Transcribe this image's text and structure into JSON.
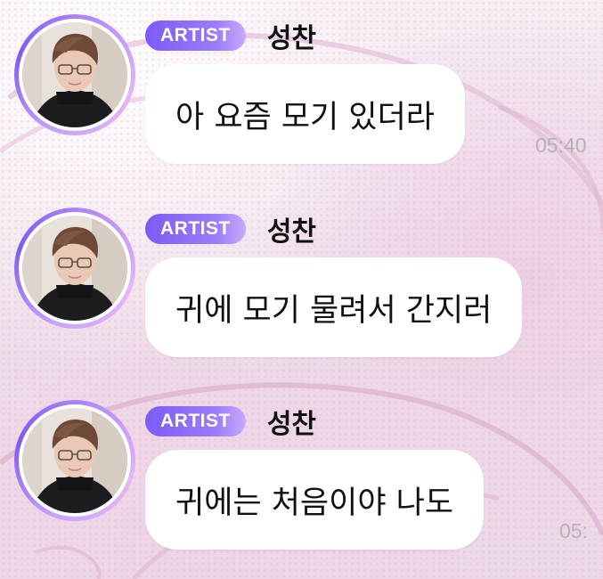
{
  "chat": {
    "messages": [
      {
        "badge": "ARTIST",
        "sender": "성찬",
        "text": "아 요즘 모기 있더라",
        "time": "05:40"
      },
      {
        "badge": "ARTIST",
        "sender": "성찬",
        "text": "귀에 모기 물려서 간지러",
        "time": ""
      },
      {
        "badge": "ARTIST",
        "sender": "성찬",
        "text": "귀에는 처음이야 나도",
        "time": "05:"
      }
    ]
  },
  "colors": {
    "badge_start": "#7c5cf6",
    "badge_end": "#c9a9ff",
    "bubble": "#ffffff",
    "timestamp": "#b9b0b6",
    "background": "#f3e6ef"
  },
  "icons": {
    "avatar": "profile-photo"
  }
}
